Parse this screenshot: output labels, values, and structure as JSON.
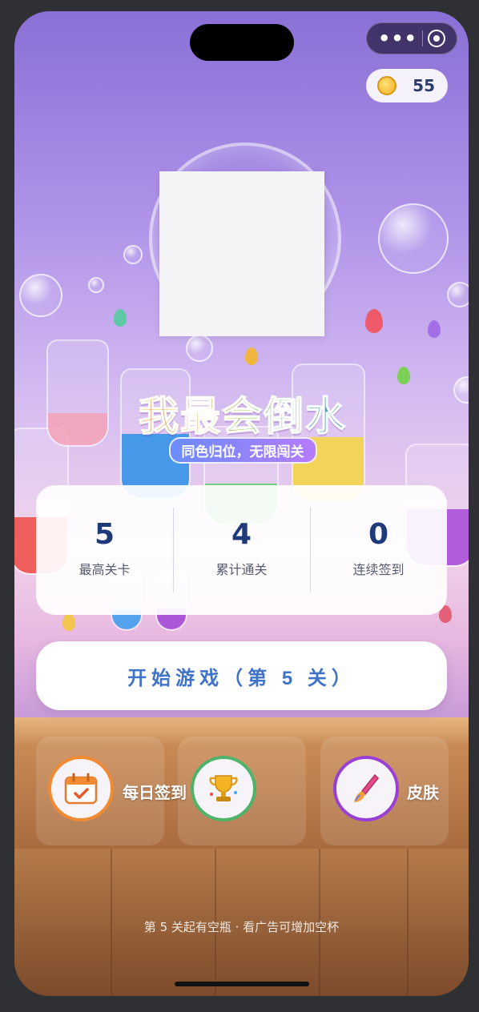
{
  "status_capsule": {
    "more_icon": "more-dots-icon",
    "close_icon": "target-icon"
  },
  "coins": {
    "icon": "coin-icon",
    "count": "55"
  },
  "logo": {
    "title": "我最会倒水",
    "subtitle": "同色归位，无限闯关"
  },
  "stats": [
    {
      "value": "5",
      "label": "最高关卡"
    },
    {
      "value": "4",
      "label": "累计通关"
    },
    {
      "value": "0",
      "label": "连续签到"
    }
  ],
  "start_button": {
    "label": "开始游戏（第 5 关）"
  },
  "features": [
    {
      "label": "每日签到",
      "icon": "calendar-icon",
      "ring": "#f08a33"
    },
    {
      "label": "",
      "icon": "trophy-icon",
      "ring": "#4fb36a"
    },
    {
      "label": "皮肤",
      "icon": "paintbrush-icon",
      "ring": "#9a3fd6"
    }
  ],
  "footer": {
    "hint": "第 5 关起有空瓶 · 看广告可增加空杯"
  },
  "colors": {
    "accent": "#3f72c9",
    "stat_number": "#1f3a7a"
  }
}
